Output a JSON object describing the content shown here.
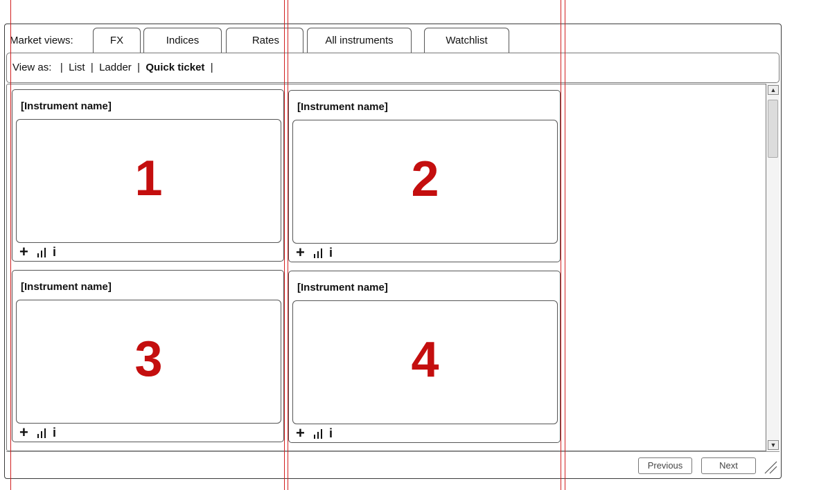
{
  "market_views": {
    "label": "Market views:",
    "tabs": [
      "FX",
      "Indices",
      "Rates",
      "All instruments",
      "Watchlist"
    ]
  },
  "view_as": {
    "label": "View as:",
    "options": [
      "List",
      "Ladder",
      "Quick ticket"
    ],
    "selected": "Quick ticket"
  },
  "cards": [
    {
      "title": "[Instrument name]",
      "number": "1"
    },
    {
      "title": "[Instrument name]",
      "number": "2"
    },
    {
      "title": "[Instrument name]",
      "number": "3"
    },
    {
      "title": "[Instrument name]",
      "number": "4"
    }
  ],
  "card_icons": [
    "plus-icon",
    "bar-chart-icon",
    "info-icon"
  ],
  "card_icon_glyphs": {
    "plus": "+",
    "info": "i"
  },
  "pager": {
    "previous": "Previous",
    "next": "Next"
  },
  "colors": {
    "guide": "#d11f1f",
    "number": "#c40e0e"
  }
}
